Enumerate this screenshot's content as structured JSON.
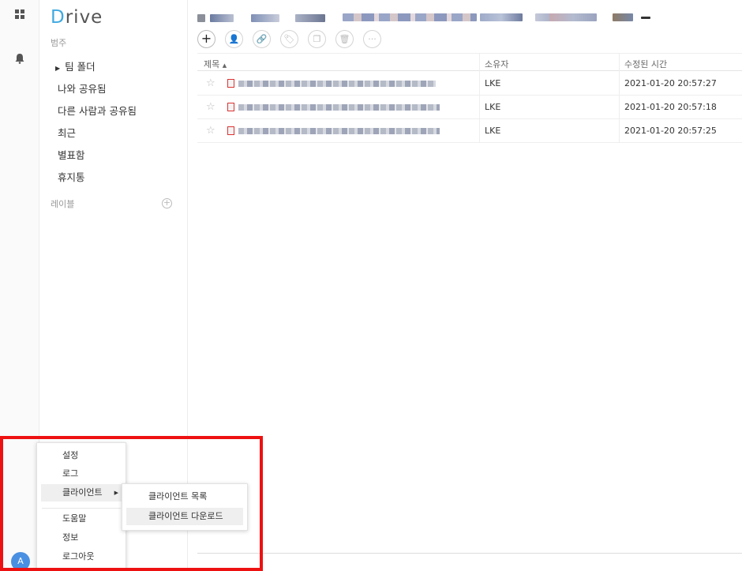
{
  "app": {
    "logo_text": "Drive",
    "logo_d": "D",
    "logo_rest": "rive"
  },
  "rail": {
    "avatar_letter": "A"
  },
  "sidebar": {
    "category_label": "범주",
    "items": [
      {
        "label": "팀 폴더"
      },
      {
        "label": "나와 공유됨"
      },
      {
        "label": "다른 사람과 공유됨"
      },
      {
        "label": "최근"
      },
      {
        "label": "별표함"
      },
      {
        "label": "휴지통"
      }
    ],
    "labels_section": "레이블"
  },
  "table": {
    "headers": {
      "title": "제목",
      "owner": "소유자",
      "modified": "수정된 시간"
    },
    "rows": [
      {
        "owner": "LKE",
        "modified": "2021-01-20 20:57:27"
      },
      {
        "owner": "LKE",
        "modified": "2021-01-20 20:57:18"
      },
      {
        "owner": "LKE",
        "modified": "2021-01-20 20:57:25"
      }
    ]
  },
  "menu": {
    "items": [
      {
        "label": "설정"
      },
      {
        "label": "로그"
      },
      {
        "label": "클라이언트"
      },
      {
        "label": "도움말"
      },
      {
        "label": "정보"
      },
      {
        "label": "로그아웃"
      }
    ],
    "submenu": [
      {
        "label": "클라이언트 목록"
      },
      {
        "label": "클라이언트 다운로드"
      }
    ]
  },
  "colors": {
    "accent": "#3fa9e0",
    "highlight_box": "#ee1111",
    "avatar": "#4a90e2"
  }
}
